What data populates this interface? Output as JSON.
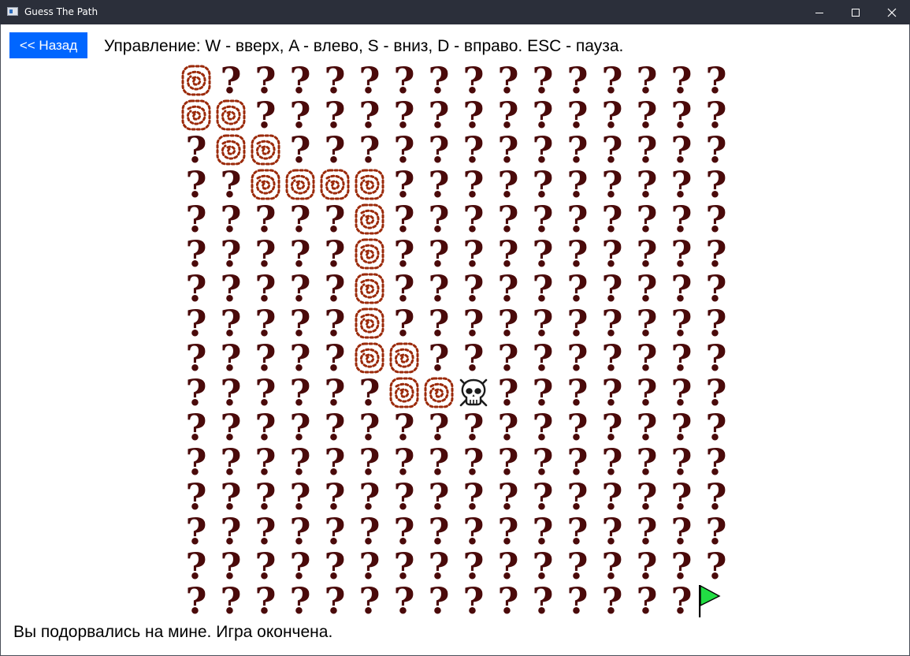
{
  "window": {
    "title": "Guess The Path",
    "controls": [
      "minimize-icon",
      "maximize-icon",
      "close-icon"
    ]
  },
  "header": {
    "back_label": "<< Назад",
    "controls_hint": "Управление: W - вверх, A - влево, S - вниз, D - вправо. ESC - пауза."
  },
  "board": {
    "columns": 16,
    "rows": 16,
    "unknown_symbol": "?",
    "colors": {
      "unknown": "#4a0a0a",
      "path": "#9b2a0a",
      "flag": "#22dd44",
      "background": "#ffffff"
    },
    "path_cells": [
      [
        0,
        0
      ],
      [
        0,
        1
      ],
      [
        1,
        1
      ],
      [
        1,
        2
      ],
      [
        2,
        2
      ],
      [
        2,
        3
      ],
      [
        3,
        3
      ],
      [
        4,
        3
      ],
      [
        5,
        3
      ],
      [
        5,
        4
      ],
      [
        5,
        5
      ],
      [
        5,
        6
      ],
      [
        5,
        7
      ],
      [
        5,
        8
      ],
      [
        6,
        8
      ],
      [
        6,
        9
      ],
      [
        7,
        9
      ]
    ],
    "mine_cell": [
      8,
      9
    ],
    "mine_icon": "skull-crossbones-icon",
    "goal_cell": [
      15,
      15
    ],
    "goal_icon": "green-flag-icon"
  },
  "status": {
    "message": "Вы подорвались на мине. Игра окончена."
  }
}
